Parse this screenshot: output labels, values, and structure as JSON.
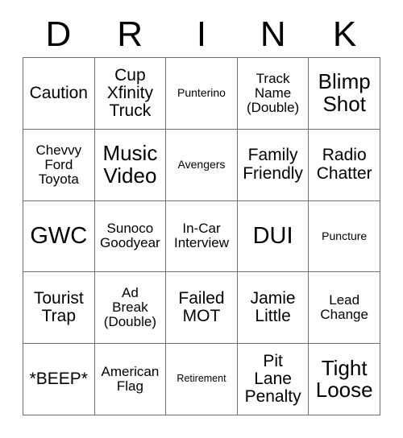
{
  "card": {
    "title_letters": [
      "D",
      "R",
      "I",
      "N",
      "K"
    ],
    "grid_size": "5x5",
    "colors": {
      "background": "#ffffff",
      "text": "#000000",
      "grid_line": "#6e6e6e"
    },
    "rows": [
      [
        {
          "text": "Caution",
          "size": "md"
        },
        {
          "text": "Cup\nXfinity\nTruck",
          "size": "md"
        },
        {
          "text": "Punterino",
          "size": "xs"
        },
        {
          "text": "Track\nName\n(Double)",
          "size": "sm"
        },
        {
          "text": "Blimp\nShot",
          "size": "lg"
        }
      ],
      [
        {
          "text": "Chevvy\nFord\nToyota",
          "size": "sm"
        },
        {
          "text": "Music\nVideo",
          "size": "lg"
        },
        {
          "text": "Avengers",
          "size": "xs"
        },
        {
          "text": "Family\nFriendly",
          "size": "md"
        },
        {
          "text": "Radio\nChatter",
          "size": "md"
        }
      ],
      [
        {
          "text": "GWC",
          "size": "xl"
        },
        {
          "text": "Sunoco\nGoodyear",
          "size": "sm"
        },
        {
          "text": "In-Car\nInterview",
          "size": "sm"
        },
        {
          "text": "DUI",
          "size": "xl"
        },
        {
          "text": "Puncture",
          "size": "xs"
        }
      ],
      [
        {
          "text": "Tourist\nTrap",
          "size": "md"
        },
        {
          "text": "Ad\nBreak\n(Double)",
          "size": "sm"
        },
        {
          "text": "Failed\nMOT",
          "size": "md"
        },
        {
          "text": "Jamie\nLittle",
          "size": "md"
        },
        {
          "text": "Lead\nChange",
          "size": "sm"
        }
      ],
      [
        {
          "text": "*BEEP*",
          "size": "md"
        },
        {
          "text": "American\nFlag",
          "size": "sm"
        },
        {
          "text": "Retirement",
          "size": "xxs"
        },
        {
          "text": "Pit\nLane\nPenalty",
          "size": "md"
        },
        {
          "text": "Tight\nLoose",
          "size": "lg"
        }
      ]
    ]
  }
}
